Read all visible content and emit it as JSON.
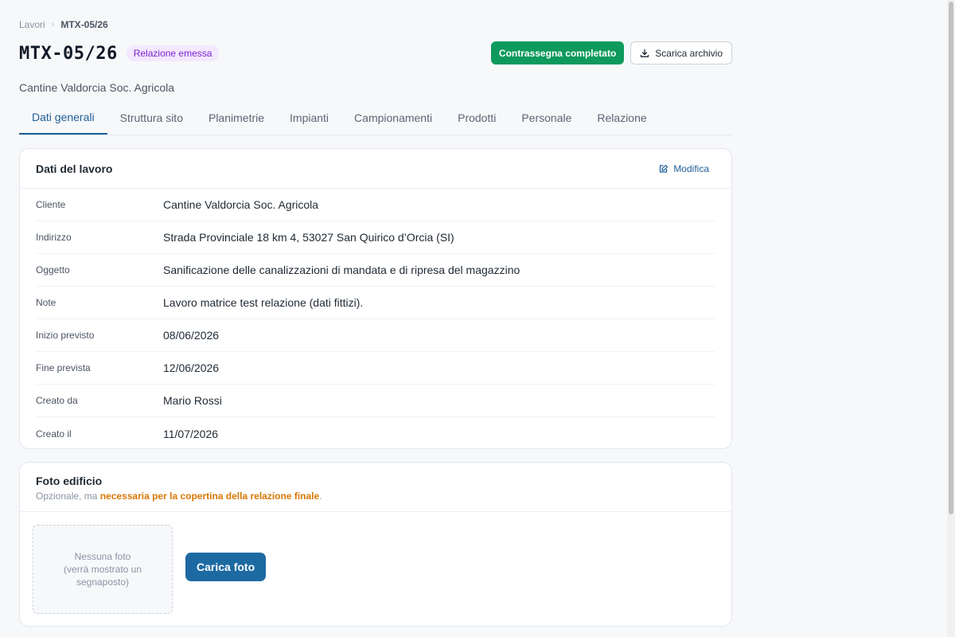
{
  "breadcrumb": {
    "parent": "Lavori",
    "separator": "›",
    "current": "MTX-05/26"
  },
  "header": {
    "title": "MTX-05/26",
    "status_badge": "Relazione emessa",
    "subtitle": "Cantine Valdorcia Soc. Agricola",
    "complete_button": "Contrassegna completato",
    "download_button": "Scarica archivio"
  },
  "tabs": [
    {
      "label": "Dati generali",
      "active": true
    },
    {
      "label": "Struttura sito",
      "active": false
    },
    {
      "label": "Planimetrie",
      "active": false
    },
    {
      "label": "Impianti",
      "active": false
    },
    {
      "label": "Campionamenti",
      "active": false
    },
    {
      "label": "Prodotti",
      "active": false
    },
    {
      "label": "Personale",
      "active": false
    },
    {
      "label": "Relazione",
      "active": false
    }
  ],
  "details": {
    "title": "Dati del lavoro",
    "edit_label": "Modifica",
    "rows": [
      {
        "label": "Cliente",
        "value": "Cantine Valdorcia Soc. Agricola"
      },
      {
        "label": "Indirizzo",
        "value": "Strada Provinciale 18 km 4, 53027 San Quirico d’Orcia (SI)"
      },
      {
        "label": "Oggetto",
        "value": "Sanificazione delle canalizzazioni di mandata e di ripresa del magazzino"
      },
      {
        "label": "Note",
        "value": "Lavoro matrice test relazione (dati fittizi)."
      },
      {
        "label": "Inizio previsto",
        "value": "08/06/2026"
      },
      {
        "label": "Fine prevista",
        "value": "12/06/2026"
      },
      {
        "label": "Creato da",
        "value": "Mario Rossi"
      },
      {
        "label": "Creato il",
        "value": "11/07/2026"
      }
    ]
  },
  "photo": {
    "title": "Foto edificio",
    "hint_prefix": "Opzionale, ma ",
    "hint_highlight": "necessaria per la copertina della relazione finale",
    "hint_suffix": ".",
    "placeholder_line1": "Nessuna foto",
    "placeholder_line2": "(verrà mostrato un segnaposto)",
    "upload_button": "Carica foto"
  },
  "colors": {
    "accent": "#1f5f99",
    "success": "#0e9a5c",
    "badge_bg": "#f3e8ff",
    "badge_text": "#7e22ce",
    "warning": "#d97706"
  },
  "icons": {
    "breadcrumb_separator": "chevron-right-icon",
    "download": "download-icon",
    "edit": "edit-icon"
  }
}
